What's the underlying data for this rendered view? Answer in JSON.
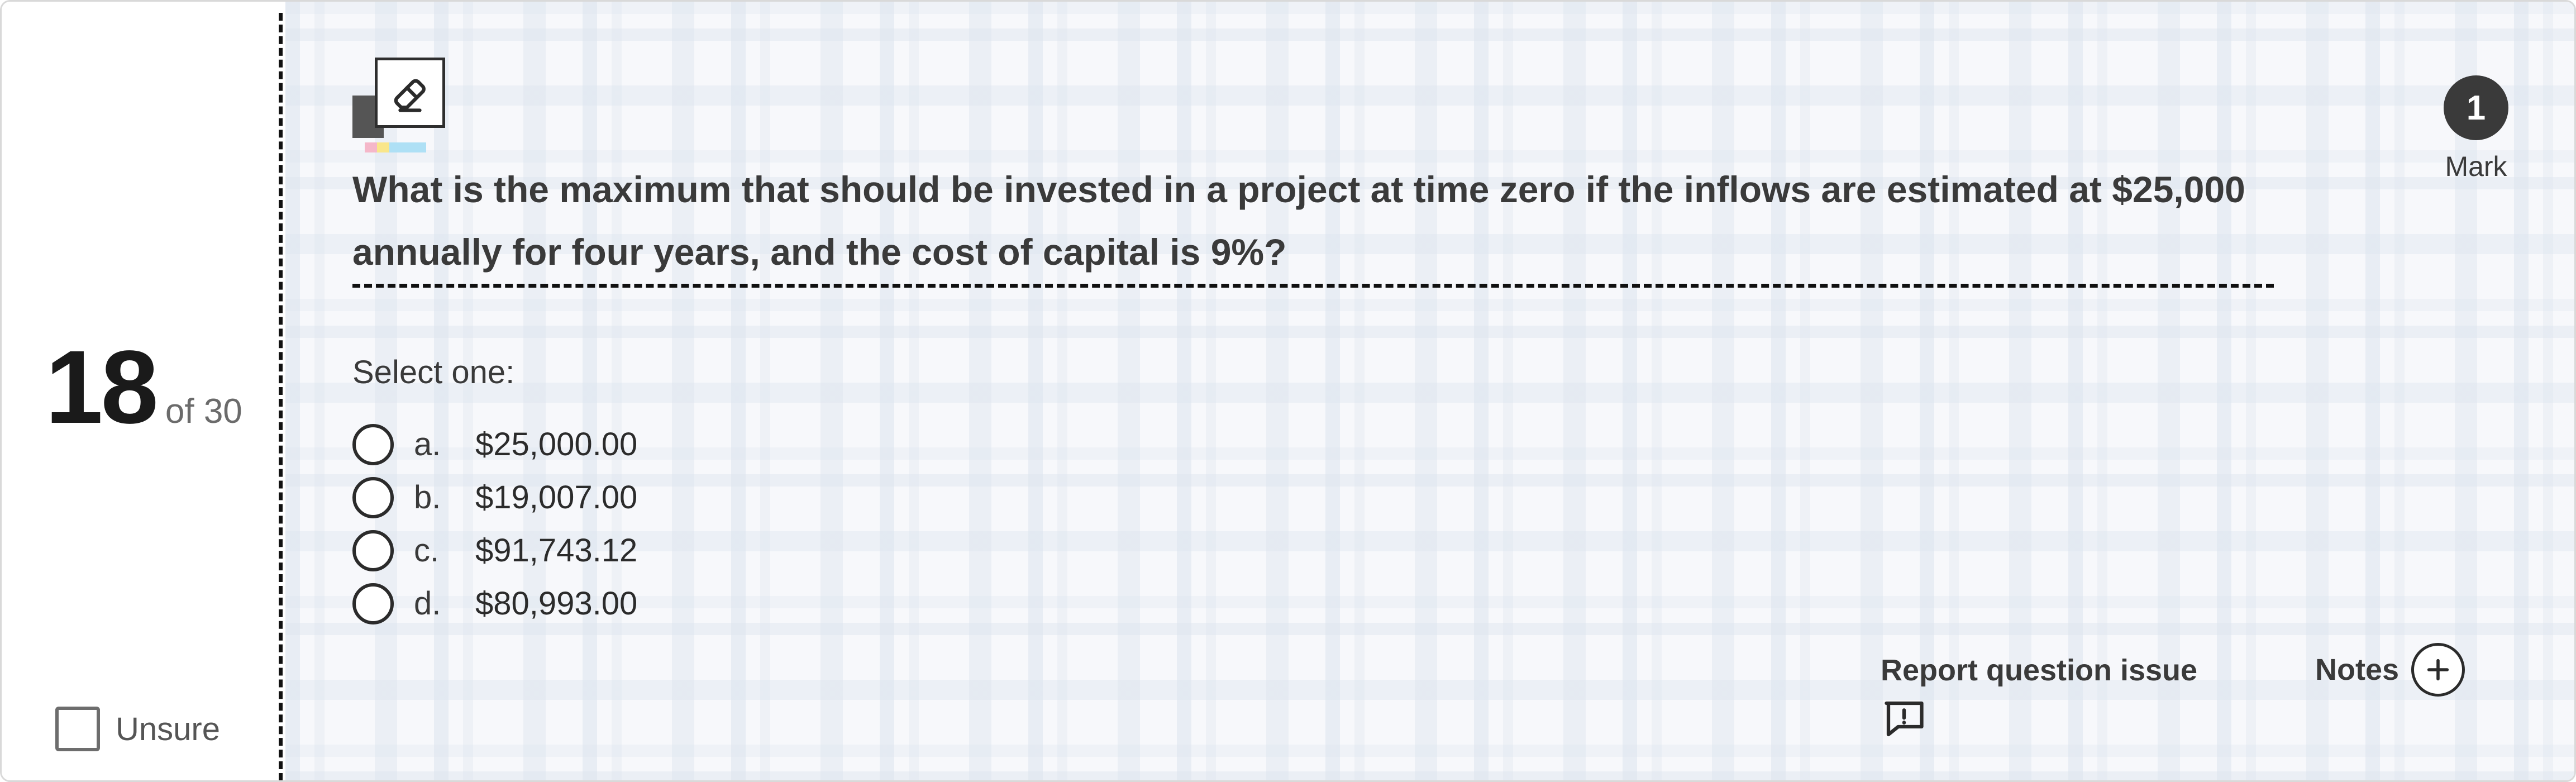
{
  "question_number": {
    "current": "18",
    "of_label": "of 30"
  },
  "unsure": {
    "label": "Unsure",
    "checked": false
  },
  "question": {
    "text": "What is the maximum that should be invested in a project at time zero if the inflows are estimated at $25,000 annually for four years, and the cost of capital is 9%?",
    "prompt": "Select one:",
    "options": [
      {
        "letter": "a.",
        "text": "$25,000.00"
      },
      {
        "letter": "b.",
        "text": "$19,007.00"
      },
      {
        "letter": "c.",
        "text": "$91,743.12"
      },
      {
        "letter": "d.",
        "text": "$80,993.00"
      }
    ]
  },
  "mark": {
    "value": "1",
    "label": "Mark"
  },
  "footer": {
    "report_label": "Report question issue",
    "notes_label": "Notes"
  },
  "icons": {
    "eraser": "eraser-icon",
    "report": "comment-exclamation-icon",
    "notes": "plus-circle-icon"
  },
  "colors": {
    "text": "#3a3a3a",
    "mark_badge": "#3a3a3a",
    "background_main": "#f7f8fb"
  }
}
